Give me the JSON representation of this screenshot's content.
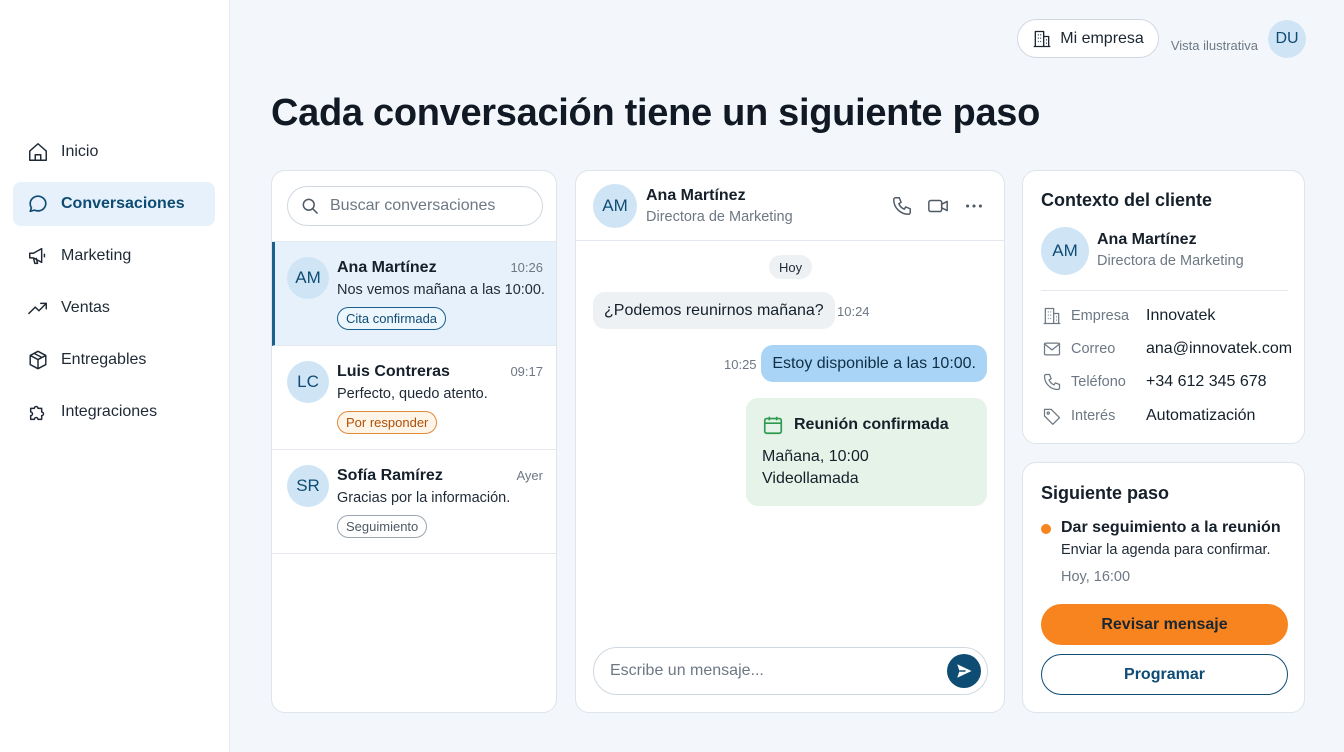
{
  "sidebar": {
    "items": [
      {
        "label": "Inicio",
        "icon": "home-icon",
        "active": false
      },
      {
        "label": "Conversaciones",
        "icon": "chat-bubble-icon",
        "active": true
      },
      {
        "label": "Marketing",
        "icon": "megaphone-icon",
        "active": false
      },
      {
        "label": "Ventas",
        "icon": "trend-up-icon",
        "active": false
      },
      {
        "label": "Entregables",
        "icon": "package-icon",
        "active": false
      },
      {
        "label": "Integraciones",
        "icon": "puzzle-icon",
        "active": false
      }
    ]
  },
  "topbar": {
    "company_label": "Mi empresa",
    "vista": "Vista ilustrativa",
    "user_initials": "DU"
  },
  "headline": "Cada conversación tiene un siguiente paso",
  "search": {
    "placeholder": "Buscar conversaciones"
  },
  "conversations": [
    {
      "initials": "AM",
      "name": "Ana Martínez",
      "time": "10:26",
      "preview": "Nos vemos mañana a las 10:00.",
      "tag": "Cita confirmada",
      "tag_color": "#1a5f8e",
      "active": true
    },
    {
      "initials": "LC",
      "name": "Luis Contreras",
      "time": "09:17",
      "preview": "Perfecto, quedo atento.",
      "tag": "Por responder",
      "tag_color": "#e08a3c",
      "active": false
    },
    {
      "initials": "SR",
      "name": "Sofía Ramírez",
      "time": "Ayer",
      "preview": "Gracias por la información.",
      "tag": "Seguimiento",
      "tag_color": "#9aa6b2",
      "active": false
    }
  ],
  "chat": {
    "contact": {
      "initials": "AM",
      "name": "Ana Martínez",
      "role": "Directora de Marketing"
    },
    "day": "Hoy",
    "incoming": {
      "text": "¿Podemos reunirnos mañana?",
      "time": "10:24"
    },
    "outgoing": {
      "text": "Estoy disponible a las 10:00.",
      "time": "10:25"
    },
    "meeting": {
      "title": "Reunión confirmada",
      "line1": "Mañana, 10:00",
      "line2": "Videollamada"
    },
    "composer_placeholder": "Escribe un mensaje..."
  },
  "context": {
    "title": "Contexto del cliente",
    "initials": "AM",
    "name": "Ana Martínez",
    "role": "Directora de Marketing",
    "fields": [
      {
        "label": "Empresa",
        "value": "Innovatek",
        "icon": "building-icon"
      },
      {
        "label": "Correo",
        "value": "ana@innovatek.com",
        "icon": "mail-icon"
      },
      {
        "label": "Teléfono",
        "value": "+34 612 345 678",
        "icon": "phone-icon"
      },
      {
        "label": "Interés",
        "value": "Automatización",
        "icon": "tag-icon"
      }
    ]
  },
  "next_step": {
    "title": "Siguiente paso",
    "step_title": "Dar seguimiento a la reunión",
    "step_desc": "Enviar la agenda para confirmar.",
    "step_time": "Hoy, 16:00",
    "primary_button": "Revisar mensaje",
    "secondary_button": "Programar"
  },
  "colors": {
    "accent": "#0f4c73",
    "active_bg": "#e6f1fb",
    "outgoing_bubble": "#a9d4f5",
    "meeting_bg": "#e5f3e8",
    "primary_button": "#f7841e"
  }
}
